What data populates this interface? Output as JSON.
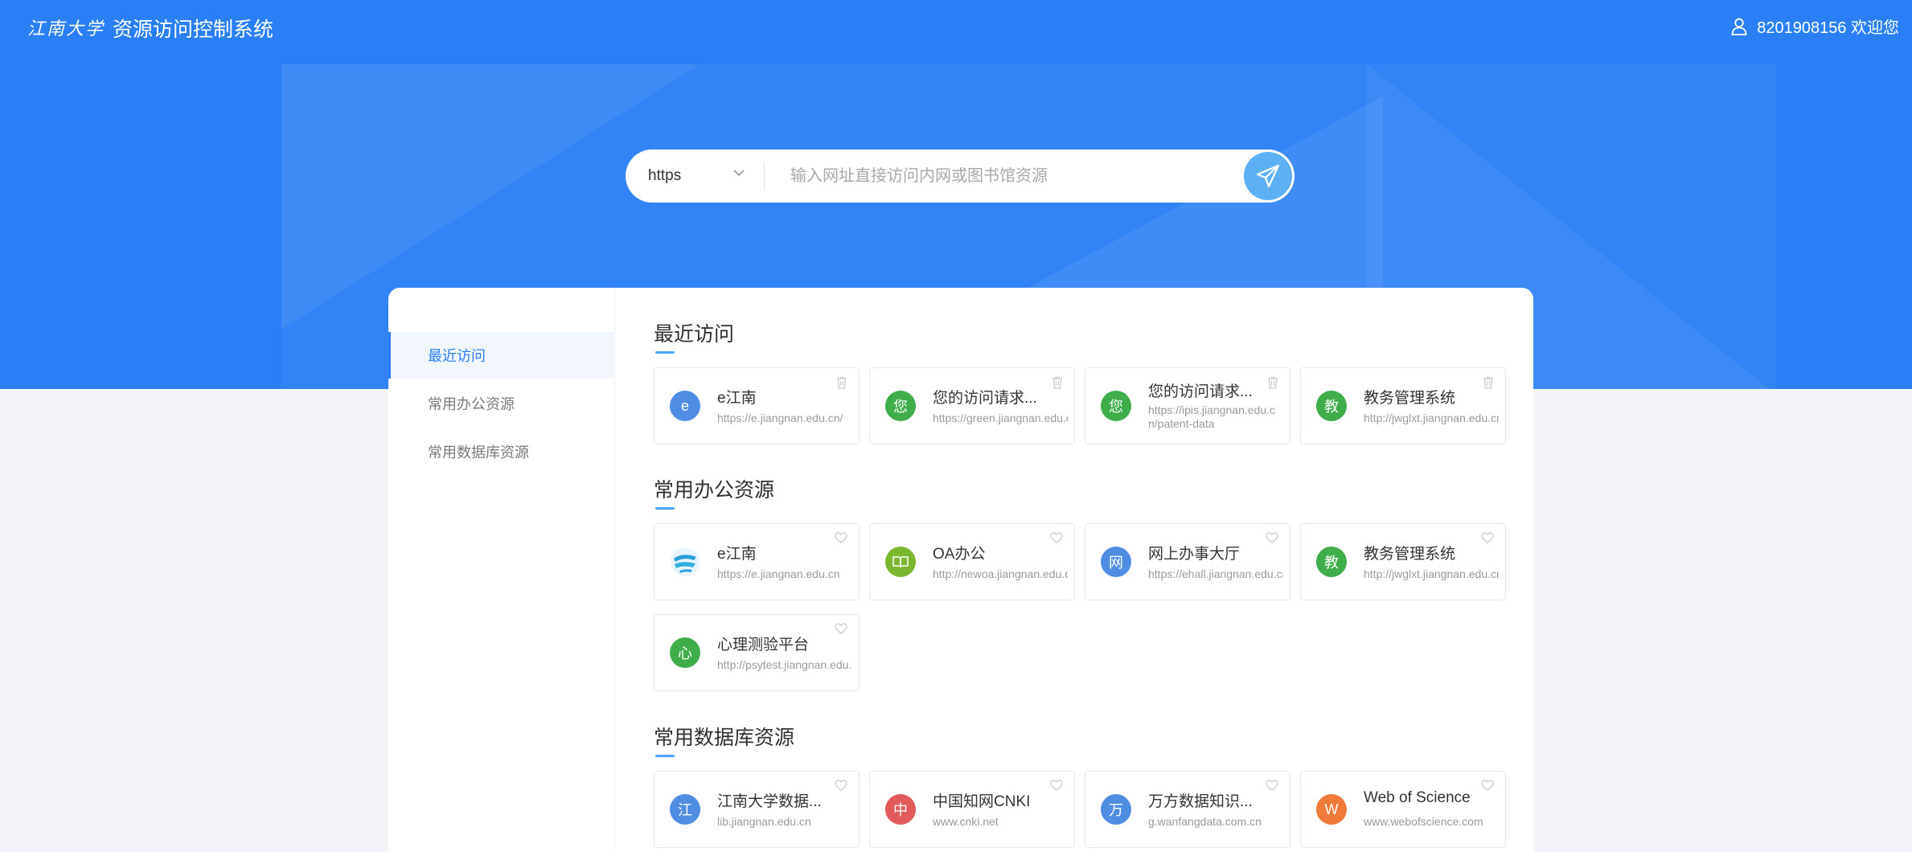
{
  "header": {
    "logo_text": "江南大学",
    "app_title": "资源访问控制系统",
    "user_text": "8201908156 欢迎您"
  },
  "search": {
    "protocol": "https",
    "placeholder": "输入网址直接访问内网或图书馆资源"
  },
  "sidebar": {
    "items": [
      {
        "label": "最近访问"
      },
      {
        "label": "常用办公资源"
      },
      {
        "label": "常用数据库资源"
      }
    ]
  },
  "sections": {
    "recent": {
      "title": "最近访问",
      "cards": [
        {
          "name": "e江南",
          "url": "https://e.jiangnan.edu.cn/",
          "avatar": "e",
          "color": "#4f8de3"
        },
        {
          "name": "您的访问请求...",
          "url": "https://green.jiangnan.edu.cn",
          "avatar": "您",
          "color": "#3fae4a"
        },
        {
          "name": "您的访问请求...",
          "url": "https://ipis.jiangnan.edu.cn/patent-data",
          "avatar": "您",
          "color": "#3fae4a"
        },
        {
          "name": "教务管理系统",
          "url": "http://jwglxt.jiangnan.edu.cn",
          "avatar": "教",
          "color": "#3fae4a"
        }
      ]
    },
    "office": {
      "title": "常用办公资源",
      "cards": [
        {
          "name": "e江南",
          "url": "https://e.jiangnan.edu.cn",
          "avatar": "",
          "color": "#ffffff"
        },
        {
          "name": "OA办公",
          "url": "http://newoa.jiangnan.edu.cn",
          "avatar": "",
          "color": "#7cb82f"
        },
        {
          "name": "网上办事大厅",
          "url": "https://ehall.jiangnan.edu.cn",
          "avatar": "网",
          "color": "#4f8de3"
        },
        {
          "name": "教务管理系统",
          "url": "http://jwglxt.jiangnan.edu.cn",
          "avatar": "教",
          "color": "#3fae4a"
        },
        {
          "name": "心理测验平台",
          "url": "http://psytest.jiangnan.edu.cn",
          "avatar": "心",
          "color": "#3fae4a"
        }
      ]
    },
    "database": {
      "title": "常用数据库资源",
      "cards": [
        {
          "name": "江南大学数据...",
          "url": "lib.jiangnan.edu.cn",
          "avatar": "江",
          "color": "#4f8de3"
        },
        {
          "name": "中国知网CNKI",
          "url": "www.cnki.net",
          "avatar": "中",
          "color": "#e25a5a"
        },
        {
          "name": "万方数据知识...",
          "url": "g.wanfangdata.com.cn",
          "avatar": "万",
          "color": "#4f8de3"
        },
        {
          "name": "Web of Science",
          "url": "www.webofscience.com",
          "avatar": "W",
          "color": "#f07a3a"
        }
      ]
    }
  }
}
